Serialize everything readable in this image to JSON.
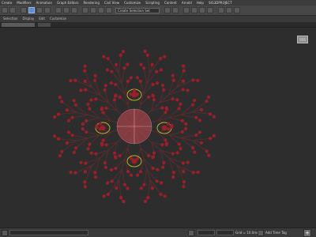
{
  "menu": [
    "Create",
    "Modifiers",
    "Animation",
    "Graph Editors",
    "Rendering",
    "Civil View",
    "Customize",
    "Scripting",
    "Content",
    "Arnold",
    "Help",
    "SIG3DPROJECT"
  ],
  "toolbar": {
    "selection_set": "Create Selection Set"
  },
  "tabs": [
    "Selection",
    "Display",
    "Edit",
    "Customize"
  ],
  "status": {
    "grid_label": "Grid = 10.0mm",
    "time_tag_label": "Add Time Tag"
  },
  "colors": {
    "node": "#9b1f2a",
    "branch": "#5a2a2e",
    "hub": "#c84b56",
    "gizmo": "#b6b02a"
  }
}
